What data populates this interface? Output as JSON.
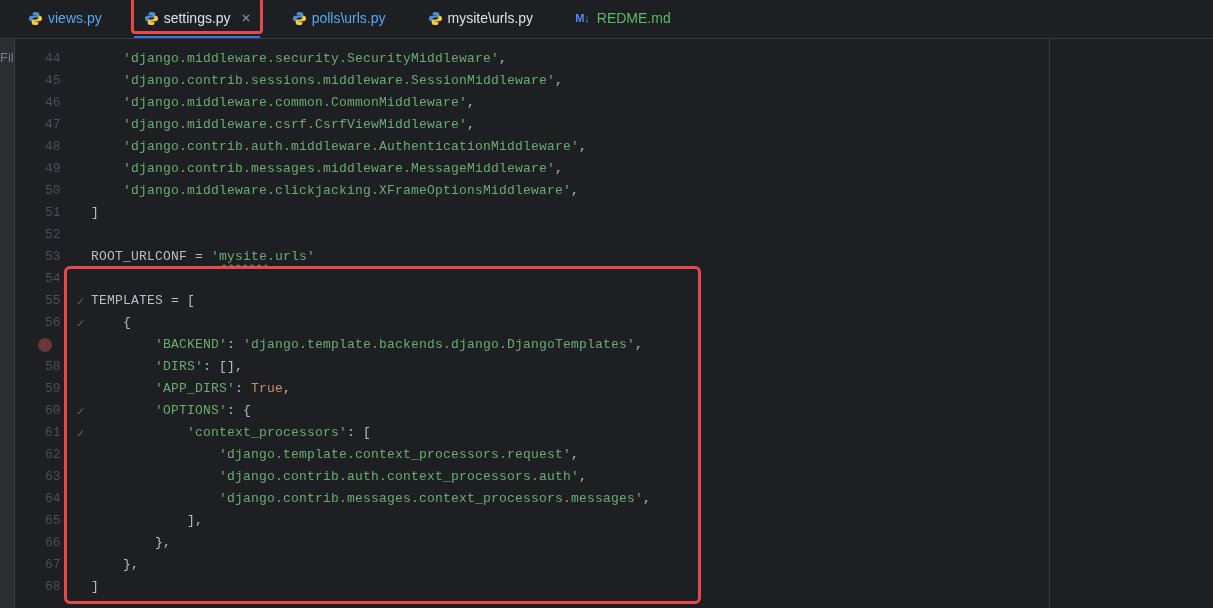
{
  "side_panel": {
    "label": "Fil"
  },
  "tabs": [
    {
      "label": "views.py",
      "color": "#56a8f5",
      "selected": false,
      "closable": false,
      "highlighted": false
    },
    {
      "label": "settings.py",
      "color": "#dfe1e5",
      "selected": true,
      "closable": true,
      "highlighted": true
    },
    {
      "label": "polls\\urls.py",
      "color": "#56a8f5",
      "selected": false,
      "closable": false,
      "highlighted": false
    },
    {
      "label": "mysite\\urls.py",
      "color": "#dfe1e5",
      "selected": false,
      "closable": false,
      "highlighted": false
    },
    {
      "label": "REDME.md",
      "icon_text": "M↓",
      "color": "#5fb865",
      "selected": false,
      "closable": false,
      "highlighted": false
    }
  ],
  "lines": [
    {
      "number": "44",
      "segments": [
        {
          "kind": "string",
          "text": "    'django.middleware.security.SecurityMiddleware'"
        },
        {
          "kind": "plain",
          "text": ","
        }
      ]
    },
    {
      "number": "45",
      "segments": [
        {
          "kind": "string",
          "text": "    'django.contrib.sessions.middleware.SessionMiddleware'"
        },
        {
          "kind": "plain",
          "text": ","
        }
      ]
    },
    {
      "number": "46",
      "segments": [
        {
          "kind": "string",
          "text": "    'django.middleware.common.CommonMiddleware'"
        },
        {
          "kind": "plain",
          "text": ","
        }
      ]
    },
    {
      "number": "47",
      "segments": [
        {
          "kind": "string",
          "text": "    'django.middleware.csrf.CsrfViewMiddleware'"
        },
        {
          "kind": "plain",
          "text": ","
        }
      ]
    },
    {
      "number": "48",
      "segments": [
        {
          "kind": "string",
          "text": "    'django.contrib.auth.middleware.AuthenticationMiddleware'"
        },
        {
          "kind": "plain",
          "text": ","
        }
      ]
    },
    {
      "number": "49",
      "segments": [
        {
          "kind": "string",
          "text": "    'django.contrib.messages.middleware.MessageMiddleware'"
        },
        {
          "kind": "plain",
          "text": ","
        }
      ]
    },
    {
      "number": "50",
      "segments": [
        {
          "kind": "string",
          "text": "    'django.middleware.clickjacking.XFrameOptionsMiddleware'"
        },
        {
          "kind": "plain",
          "text": ","
        }
      ]
    },
    {
      "number": "51",
      "segments": [
        {
          "kind": "plain",
          "text": "]"
        }
      ]
    },
    {
      "number": "52"
    },
    {
      "number": "53",
      "segments": [
        {
          "kind": "plain",
          "text": "ROOT_URLCONF = "
        },
        {
          "kind": "string",
          "text": "'"
        },
        {
          "kind": "string",
          "text": "mysite",
          "wavy": true
        },
        {
          "kind": "string",
          "text": ".urls'"
        }
      ]
    }
  ],
  "highlighted_lines": [
    {
      "number": "54"
    },
    {
      "number": "55",
      "fold_mark": true,
      "segments": [
        {
          "kind": "plain",
          "text": "TEMPLATES = ["
        }
      ]
    },
    {
      "number": "56",
      "fold_mark": true,
      "segments": [
        {
          "kind": "plain",
          "text": "    {"
        }
      ]
    },
    {
      "breakpoint": true,
      "segments": [
        {
          "kind": "string",
          "text": "        'BACKEND'"
        },
        {
          "kind": "plain",
          "text": ": "
        },
        {
          "kind": "string",
          "text": "'django.template.backends.django.DjangoTemplates'"
        },
        {
          "kind": "plain",
          "text": ","
        }
      ]
    },
    {
      "number": "58",
      "segments": [
        {
          "kind": "string",
          "text": "        'DIRS'"
        },
        {
          "kind": "plain",
          "text": ": [],"
        }
      ]
    },
    {
      "number": "59",
      "segments": [
        {
          "kind": "string",
          "text": "        'APP_DIRS'"
        },
        {
          "kind": "plain",
          "text": ": "
        },
        {
          "kind": "keyword",
          "text": "True"
        },
        {
          "kind": "plain",
          "text": ","
        }
      ]
    },
    {
      "number": "60",
      "fold_mark": true,
      "segments": [
        {
          "kind": "string",
          "text": "        'OPTIONS'"
        },
        {
          "kind": "plain",
          "text": ": {"
        }
      ]
    },
    {
      "number": "61",
      "fold_mark": true,
      "segments": [
        {
          "kind": "string",
          "text": "            'context_processors'"
        },
        {
          "kind": "plain",
          "text": ": ["
        }
      ]
    },
    {
      "number": "62",
      "segments": [
        {
          "kind": "string",
          "text": "                'django.template.context_processors.request'"
        },
        {
          "kind": "plain",
          "text": ","
        }
      ]
    },
    {
      "number": "63",
      "segments": [
        {
          "kind": "string",
          "text": "                'django.contrib.auth.context_processors.auth'"
        },
        {
          "kind": "plain",
          "text": ","
        }
      ]
    },
    {
      "number": "64",
      "segments": [
        {
          "kind": "string",
          "text": "                'django.contrib.messages.context_processors.messages'"
        },
        {
          "kind": "plain",
          "text": ","
        }
      ]
    },
    {
      "number": "65",
      "segments": [
        {
          "kind": "plain",
          "text": "            ],"
        }
      ]
    },
    {
      "number": "66",
      "segments": [
        {
          "kind": "plain",
          "text": "        },"
        }
      ]
    },
    {
      "number": "67",
      "segments": [
        {
          "kind": "plain",
          "text": "    },"
        }
      ]
    },
    {
      "number": "68",
      "segments": [
        {
          "kind": "plain",
          "text": "]"
        }
      ]
    }
  ]
}
